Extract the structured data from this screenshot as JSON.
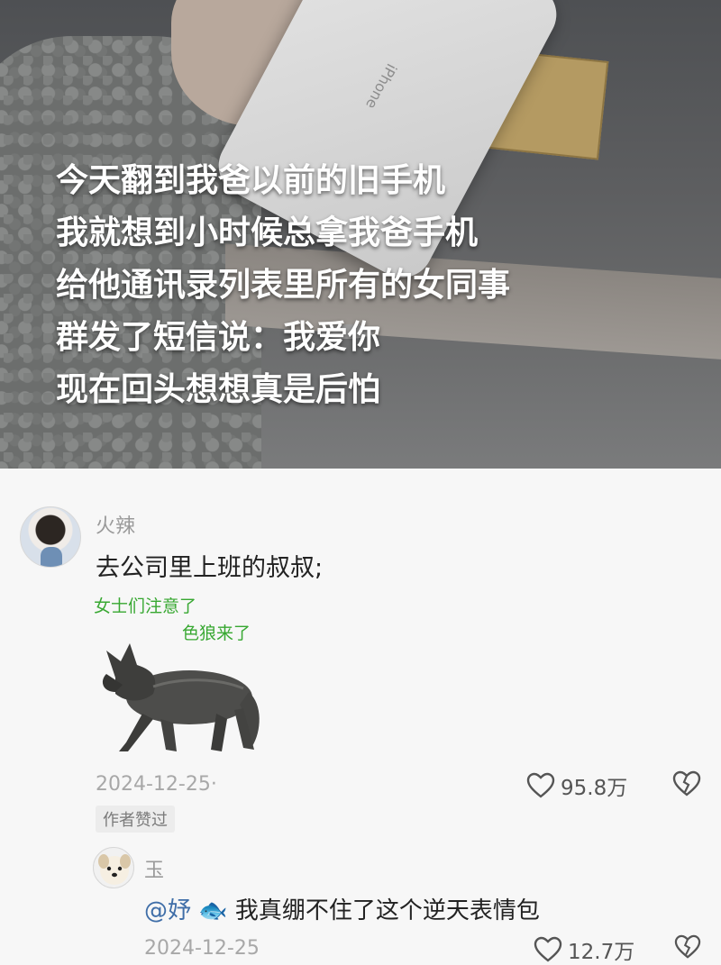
{
  "video": {
    "phone_brand": "iPhone",
    "caption_lines": [
      "今天翻到我爸以前的旧手机",
      "我就想到小时候总拿我爸手机",
      "给他通讯录列表里所有的女同事",
      "群发了短信说：我爱你",
      "现在回头想想真是后怕"
    ]
  },
  "comments": [
    {
      "username": "火辣",
      "text": "去公司里上班的叔叔;",
      "sticker": {
        "line1": "女士们注意了",
        "line2": "色狼来了"
      },
      "date": "2024-12-25·",
      "likes": "95.8万",
      "badge": "作者赞过"
    }
  ],
  "reply": {
    "username": "玉",
    "mention": "@妤",
    "mention_emoji": "🐟",
    "text": "我真绷不住了这个逆天表情包",
    "date": "2024-12-25",
    "likes": "12.7万"
  },
  "colors": {
    "caption": "#ffffff",
    "sticker_text": "#38a832",
    "mention": "#3f6ea8",
    "meta": "#a8a8a8"
  },
  "icons": {
    "like": "heart-outline-icon",
    "dislike": "broken-heart-icon"
  }
}
